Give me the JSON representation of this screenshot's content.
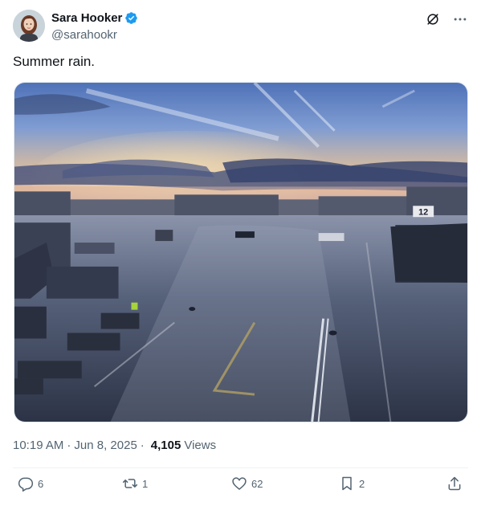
{
  "author": {
    "display_name": "Sara Hooker",
    "handle": "@sarahookr",
    "verified": true
  },
  "icons": {
    "verified": "verified-badge-icon",
    "grok": "grok-icon",
    "more": "more-icon",
    "reply": "reply-icon",
    "repost": "repost-icon",
    "like": "like-icon",
    "bookmark": "bookmark-icon",
    "share": "share-icon"
  },
  "tweet": {
    "text": "Summer rain.",
    "time": "10:19 AM",
    "date": "Jun 8, 2025",
    "views_count": "4,105",
    "views_label": "Views",
    "separator": "·"
  },
  "metrics": {
    "replies": "6",
    "reposts": "1",
    "likes": "62",
    "bookmarks": "2"
  },
  "media": {
    "gate_sign": "12"
  },
  "colors": {
    "text_primary": "#0f1419",
    "text_secondary": "#536471",
    "verified_blue": "#1d9bf0",
    "divider": "#eff3f4"
  }
}
